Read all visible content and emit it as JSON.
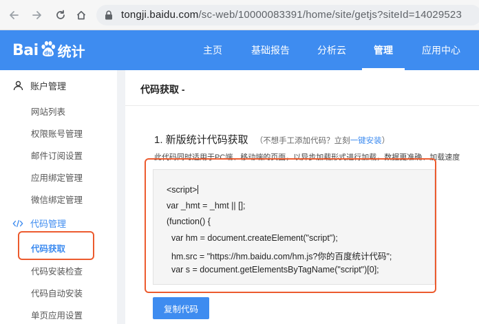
{
  "browser": {
    "url_host": "tongji.baidu.com",
    "url_path": "/sc-web/10000083391/home/site/getjs?siteId=14029523"
  },
  "header": {
    "logo_bai": "Bai",
    "logo_tongji": "统计",
    "nav": [
      {
        "label": "主页"
      },
      {
        "label": "基础报告"
      },
      {
        "label": "分析云"
      },
      {
        "label": "管理",
        "active": true
      },
      {
        "label": "应用中心"
      }
    ]
  },
  "sidebar": {
    "groups": [
      {
        "label": "账户管理",
        "icon": "user-icon"
      },
      {
        "label": "代码管理",
        "icon": "code-icon"
      }
    ],
    "account_items": [
      "网站列表",
      "权限账号管理",
      "邮件订阅设置",
      "应用绑定管理",
      "微信绑定管理"
    ],
    "code_items": [
      "代码获取",
      "代码安装检查",
      "代码自动安装",
      "单页应用设置"
    ]
  },
  "main": {
    "title": "代码获取 -",
    "section_title": "1. 新版统计代码获取",
    "hint_prefix": "（不想手工添加代码？立刻",
    "hint_link": "一键安装",
    "hint_suffix": "）",
    "desc": "此代码同时适用于PC端、移动端的页面，以异步加载形式进行加载，数据更准确、加载速度",
    "code_lines": [
      "<script>",
      "var _hmt = _hmt || [];",
      "(function() {",
      "  var hm = document.createElement(\"script\");",
      "  hm.src = \"https://hm.baidu.com/hm.js?你的百度统计代码\";",
      "  var s = document.getElementsByTagName(\"script\")[0];"
    ],
    "copy_label": "复制代码"
  },
  "colors": {
    "brand": "#3e8cf0",
    "highlight_box": "#ec5a2d"
  }
}
